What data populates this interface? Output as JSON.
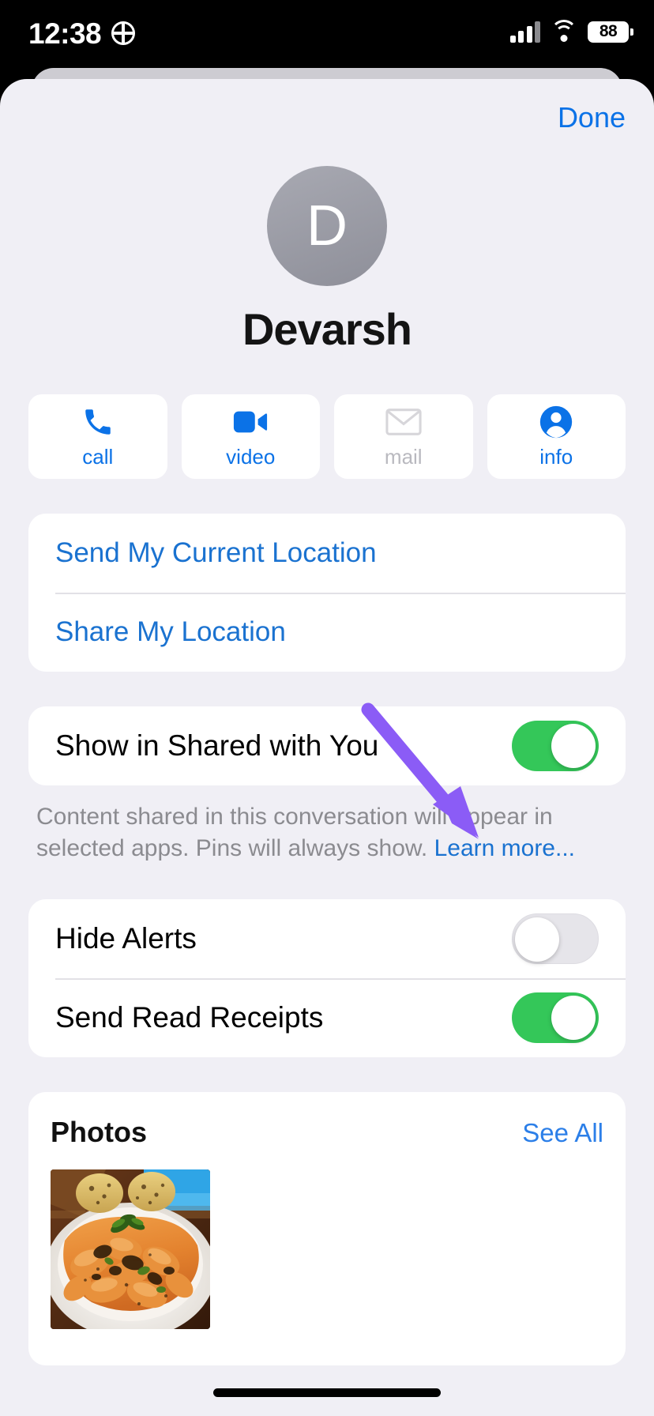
{
  "status_bar": {
    "time": "12:38",
    "location_icon": "globe-icon",
    "signal_icon": "cellular-signal-icon",
    "wifi_icon": "wifi-icon",
    "battery_percent": "88"
  },
  "header": {
    "done_label": "Done"
  },
  "contact": {
    "avatar_initial": "D",
    "name": "Devarsh"
  },
  "actions": [
    {
      "icon": "phone-icon",
      "label": "call",
      "enabled": true
    },
    {
      "icon": "video-icon",
      "label": "video",
      "enabled": true
    },
    {
      "icon": "mail-icon",
      "label": "mail",
      "enabled": false
    },
    {
      "icon": "person-circle-icon",
      "label": "info",
      "enabled": true
    }
  ],
  "location_card": {
    "send_current": "Send My Current Location",
    "share": "Share My Location"
  },
  "shared_with_you": {
    "label": "Show in Shared with You",
    "toggle_state": "on",
    "footnote_text": "Content shared in this conversation will appear in selected apps. Pins will always show. ",
    "footnote_link": "Learn more..."
  },
  "alerts_card": {
    "hide_alerts_label": "Hide Alerts",
    "hide_alerts_state": "off",
    "read_receipts_label": "Send Read Receipts",
    "read_receipts_state": "on"
  },
  "photos": {
    "title": "Photos",
    "see_all_label": "See All",
    "thumbnail_alt": "pasta-dish-photo"
  },
  "colors": {
    "accent_blue": "#0b72e7",
    "link_blue": "#1a72d0",
    "toggle_green": "#34c759",
    "sheet_bg": "#f0eff5",
    "card_bg": "#ffffff",
    "annotation_purple": "#8b5cf6",
    "disabled_gray": "#b9b9bf"
  }
}
